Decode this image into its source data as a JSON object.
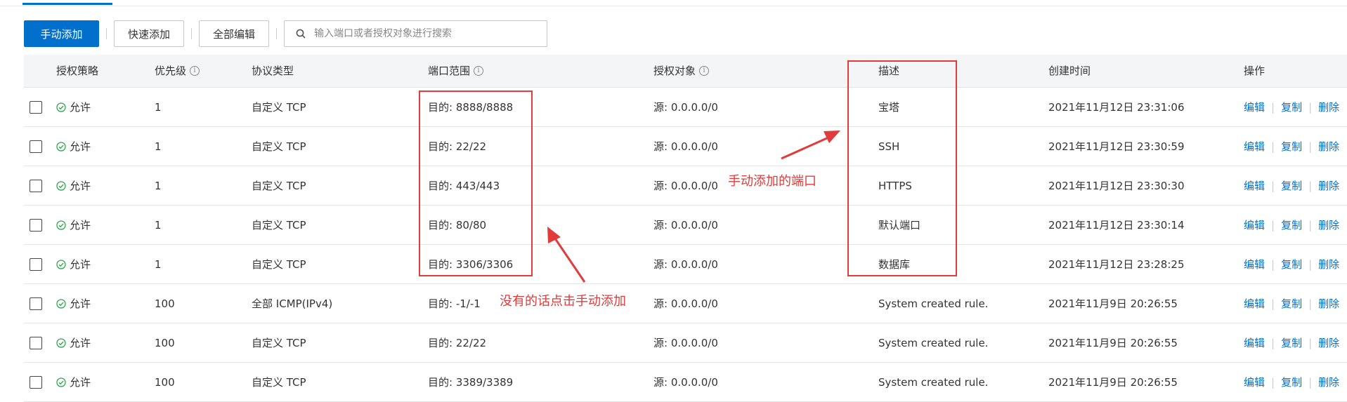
{
  "toolbar": {
    "manual_add_label": "手动添加",
    "quick_add_label": "快速添加",
    "edit_all_label": "全部编辑",
    "search_placeholder": "输入端口或者授权对象进行搜索"
  },
  "table": {
    "headers": {
      "policy": "授权策略",
      "priority": "优先级",
      "protocol": "协议类型",
      "port_range": "端口范围",
      "auth_object": "授权对象",
      "description": "描述",
      "created_time": "创建时间",
      "operations": "操作"
    },
    "info_symbol": "i",
    "op_labels": {
      "edit": "编辑",
      "copy": "复制",
      "delete": "删除"
    },
    "rows": [
      {
        "policy": "允许",
        "priority": "1",
        "protocol": "自定义 TCP",
        "port": "目的: 8888/8888",
        "object": "源: 0.0.0.0/0",
        "description": "宝塔",
        "time": "2021年11月12日 23:31:06"
      },
      {
        "policy": "允许",
        "priority": "1",
        "protocol": "自定义 TCP",
        "port": "目的: 22/22",
        "object": "源: 0.0.0.0/0",
        "description": "SSH",
        "time": "2021年11月12日 23:30:59"
      },
      {
        "policy": "允许",
        "priority": "1",
        "protocol": "自定义 TCP",
        "port": "目的: 443/443",
        "object": "源: 0.0.0.0/0",
        "description": "HTTPS",
        "time": "2021年11月12日 23:30:30"
      },
      {
        "policy": "允许",
        "priority": "1",
        "protocol": "自定义 TCP",
        "port": "目的: 80/80",
        "object": "源: 0.0.0.0/0",
        "description": "默认端口",
        "time": "2021年11月12日 23:30:14"
      },
      {
        "policy": "允许",
        "priority": "1",
        "protocol": "自定义 TCP",
        "port": "目的: 3306/3306",
        "object": "源: 0.0.0.0/0",
        "description": "数据库",
        "time": "2021年11月12日 23:28:25"
      },
      {
        "policy": "允许",
        "priority": "100",
        "protocol": "全部 ICMP(IPv4)",
        "port": "目的: -1/-1",
        "object": "源: 0.0.0.0/0",
        "description": "System created rule.",
        "time": "2021年11月9日 20:26:55"
      },
      {
        "policy": "允许",
        "priority": "100",
        "protocol": "自定义 TCP",
        "port": "目的: 22/22",
        "object": "源: 0.0.0.0/0",
        "description": "System created rule.",
        "time": "2021年11月9日 20:26:55"
      },
      {
        "policy": "允许",
        "priority": "100",
        "protocol": "自定义 TCP",
        "port": "目的: 3389/3389",
        "object": "源: 0.0.0.0/0",
        "description": "System created rule.",
        "time": "2021年11月9日 20:26:55"
      }
    ]
  },
  "annotations": {
    "manual_ports_note": "手动添加的端口",
    "no_port_note": "没有的话点击手动添加"
  },
  "colors": {
    "primary": "#0070cc",
    "annotation": "#e13b3b",
    "allow_green": "#2fa84f"
  }
}
